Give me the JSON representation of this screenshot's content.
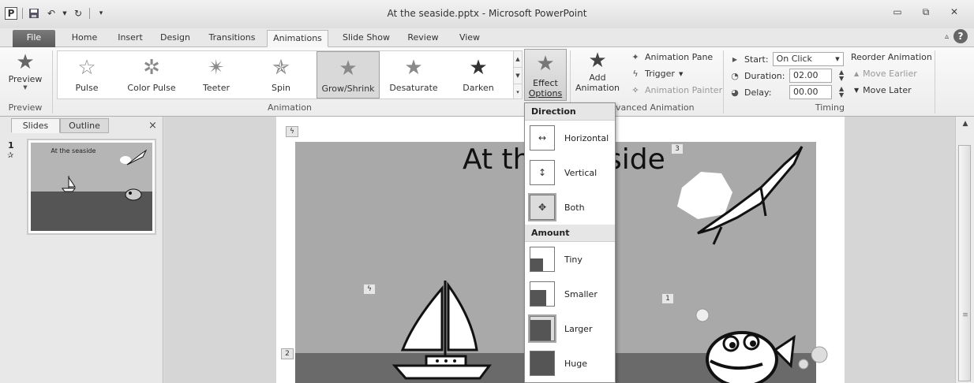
{
  "window": {
    "title": "At the seaside.pptx - Microsoft PowerPoint"
  },
  "qat": {
    "app_icon_label": "P"
  },
  "tabs": [
    "File",
    "Home",
    "Insert",
    "Design",
    "Transitions",
    "Animations",
    "Slide Show",
    "Review",
    "View"
  ],
  "ribbon": {
    "preview_group": {
      "button_label": "Preview",
      "group_label": "Preview"
    },
    "animation_group": {
      "group_label": "Animation",
      "gallery": [
        "Pulse",
        "Color Pulse",
        "Teeter",
        "Spin",
        "Grow/Shrink",
        "Desaturate",
        "Darken"
      ],
      "selected": "Grow/Shrink",
      "effect_options_line1": "Effect",
      "effect_options_line2": "Options"
    },
    "advanced_group": {
      "group_label": "vanced Animation",
      "add_animation_line1": "Add",
      "add_animation_line2": "Animation",
      "animation_pane": "Animation Pane",
      "trigger": "Trigger",
      "animation_painter": "Animation Painter"
    },
    "timing_group": {
      "group_label": "Timing",
      "start_label": "Start:",
      "start_value": "On Click",
      "duration_label": "Duration:",
      "duration_value": "02.00",
      "delay_label": "Delay:",
      "delay_value": "00.00",
      "reorder_label": "Reorder Animation",
      "move_earlier": "Move Earlier",
      "move_later": "Move Later"
    }
  },
  "left_pane": {
    "tabs": [
      "Slides",
      "Outline"
    ],
    "close": "×",
    "slide_number": "1",
    "thumb_title": "At the seaside"
  },
  "slide": {
    "title_text": "At the seaside",
    "tags": [
      "3",
      "1",
      "2"
    ]
  },
  "dropdown": {
    "direction_header": "Direction",
    "direction_items": [
      {
        "label": "Horizontal",
        "mnemonic": ""
      },
      {
        "label": "Vertical",
        "mnemonic": "V"
      },
      {
        "label": "Both",
        "mnemonic": "B"
      }
    ],
    "amount_header": "Amount",
    "amount_items": [
      {
        "label": "Tiny",
        "mnemonic": "T"
      },
      {
        "label": "Smaller",
        "mnemonic": "S"
      },
      {
        "label": "Larger",
        "mnemonic": "L"
      },
      {
        "label": "Huge",
        "mnemonic": "g"
      }
    ],
    "selected_direction": "Both",
    "selected_amount": "Larger"
  }
}
